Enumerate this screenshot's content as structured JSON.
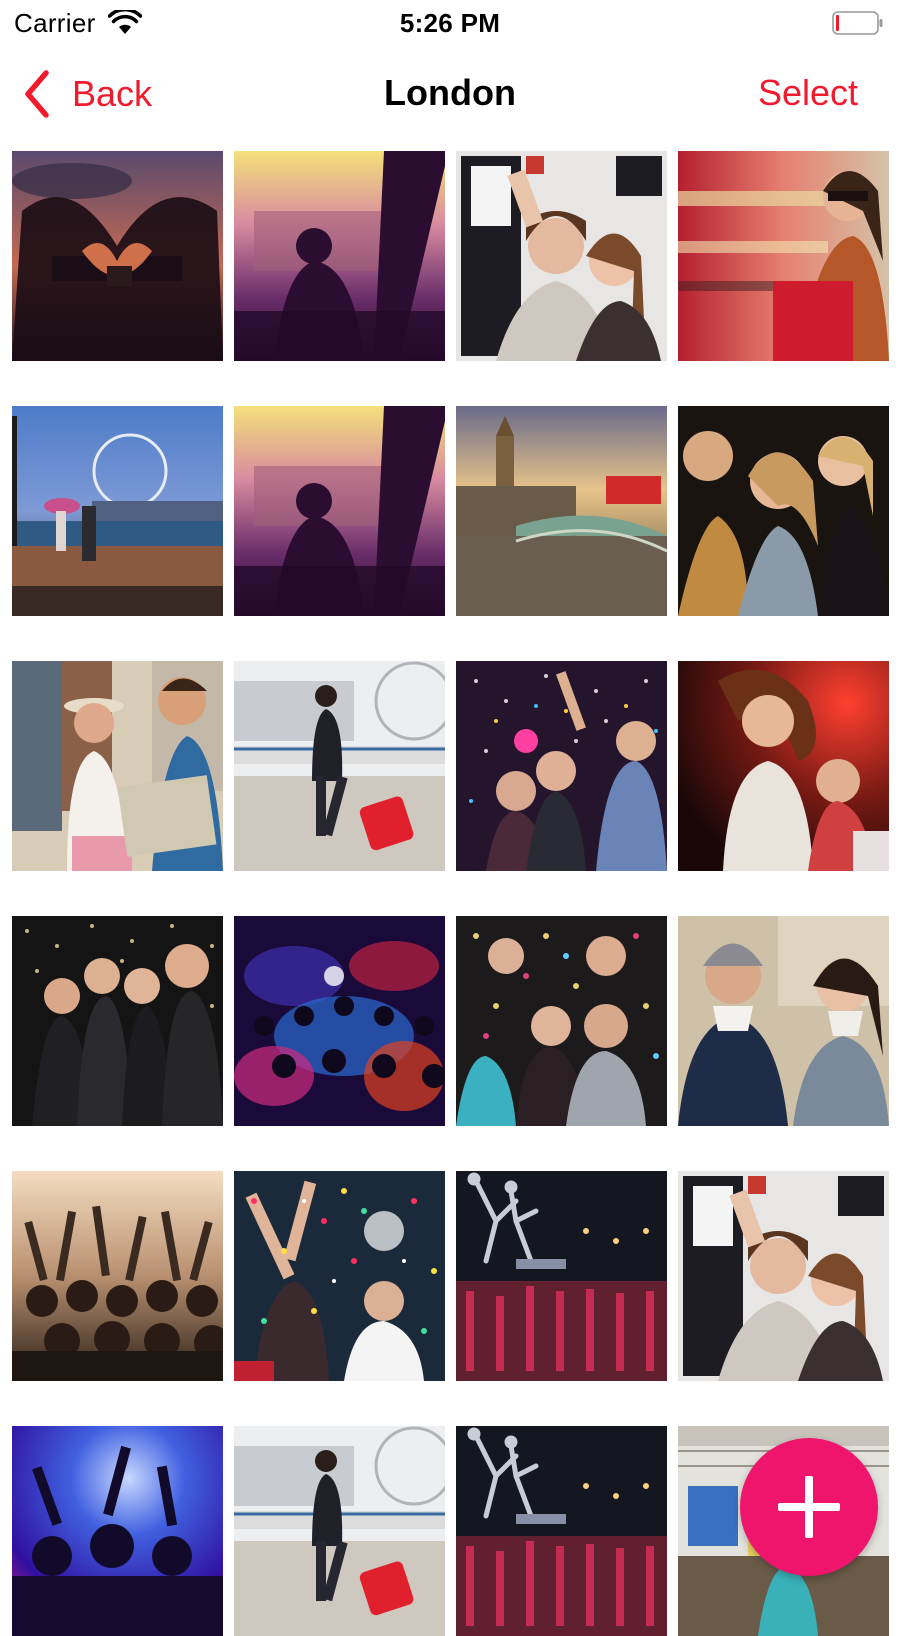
{
  "status_bar": {
    "carrier": "Carrier",
    "time": "5:26 PM",
    "battery_color": "#f21a2d"
  },
  "nav": {
    "back_label": "Back",
    "title": "London",
    "select_label": "Select",
    "accent_color": "#f21a2d",
    "back_icon": "chevron-left-icon"
  },
  "photos": [
    "heart-hands-parliament",
    "sunset-window-silhouette",
    "selfie-friends",
    "woman-shopping-bus",
    "london-eye-riverside",
    "sunset-window-silhouette",
    "big-ben-bridge",
    "party-women",
    "tourist-couple-map",
    "woman-suitcase-riverside",
    "confetti-party-crowd",
    "dancing-woman-red-lights",
    "friends-confetti-night",
    "nightclub-dance-floor",
    "confetti-celebration",
    "coffee-couple",
    "concert-crowd-hands",
    "confetti-burst-party",
    "city-sculpture-night",
    "selfie-friends",
    "blue-lights-concert",
    "woman-suitcase-riverside",
    "city-sculpture-night",
    "market-stall"
  ],
  "fab": {
    "icon": "plus-icon",
    "color": "#f0156c"
  }
}
